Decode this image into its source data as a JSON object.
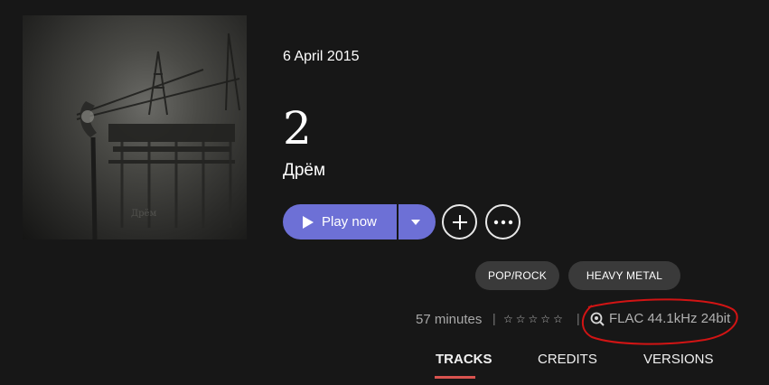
{
  "album": {
    "release_date": "6 April 2015",
    "title": "2",
    "artist": "Дрём",
    "cover_alt": "album-cover"
  },
  "actions": {
    "play_label": "Play now",
    "play_dropdown_icon": "caret-down-icon",
    "add_icon": "plus-icon",
    "more_icon": "ellipsis-icon"
  },
  "genres": [
    "POP/ROCK",
    "HEAVY METAL"
  ],
  "meta": {
    "duration": "57 minutes",
    "separator": "|",
    "rating_stars": 5,
    "rating_value": 0,
    "quality_icon": "hi-res-search-icon",
    "quality": "FLAC 44.1kHz 24bit"
  },
  "colors": {
    "accent": "#6d70d6",
    "tab_underline": "#d9534f",
    "annotation": "#d21414"
  },
  "tabs": [
    {
      "label": "TRACKS",
      "active": true
    },
    {
      "label": "CREDITS",
      "active": false
    },
    {
      "label": "VERSIONS",
      "active": false
    }
  ]
}
